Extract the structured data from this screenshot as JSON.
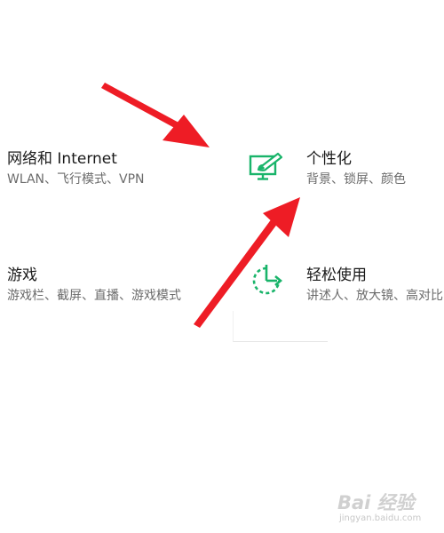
{
  "settings": {
    "tiles": [
      {
        "id": "network",
        "title": "网络和 Internet",
        "desc": "WLAN、飞行模式、VPN"
      },
      {
        "id": "personalization",
        "title": "个性化",
        "desc": "背景、锁屏、颜色",
        "icon": "personalization-pen-monitor-icon"
      },
      {
        "id": "gaming",
        "title": "游戏",
        "desc": "游戏栏、截屏、直播、游戏模式"
      },
      {
        "id": "ease-of-access",
        "title": "轻松使用",
        "desc": "讲述人、放大镜、高对比",
        "icon": "ease-of-access-timer-icon"
      }
    ],
    "accent_color": "#19b46a"
  },
  "annotations": {
    "arrow_color": "#ee1c25"
  },
  "watermark": {
    "logo_text": "Bai 经验",
    "url": "jingyan.baidu.com"
  }
}
